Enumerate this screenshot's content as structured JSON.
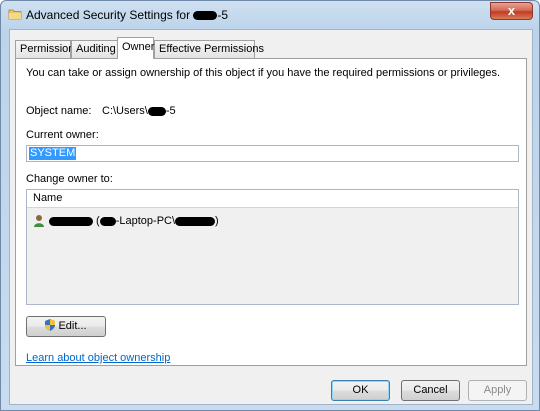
{
  "window": {
    "title_prefix": "Advanced Security Settings for ",
    "title_suffix": "-5",
    "close_label": "x"
  },
  "tabs": [
    {
      "label": "Permissions"
    },
    {
      "label": "Auditing"
    },
    {
      "label": "Owner"
    },
    {
      "label": "Effective Permissions"
    }
  ],
  "active_tab": "Owner",
  "owner_page": {
    "info_text": "You can take or assign ownership of this object if you have the required permissions or privileges.",
    "object_name_label": "Object name:",
    "object_name_prefix": "C:\\Users\\",
    "object_name_suffix": "-5",
    "current_owner_label": "Current owner:",
    "current_owner_value": "SYSTEM",
    "change_owner_label": "Change owner to:",
    "list_header": "Name",
    "list_item_part1": " (",
    "list_item_part2": "-Laptop-PC\\",
    "list_item_part3": ")",
    "edit_button": "Edit...",
    "learn_link": "Learn about object ownership"
  },
  "buttons": {
    "ok": "OK",
    "cancel": "Cancel",
    "apply": "Apply"
  }
}
